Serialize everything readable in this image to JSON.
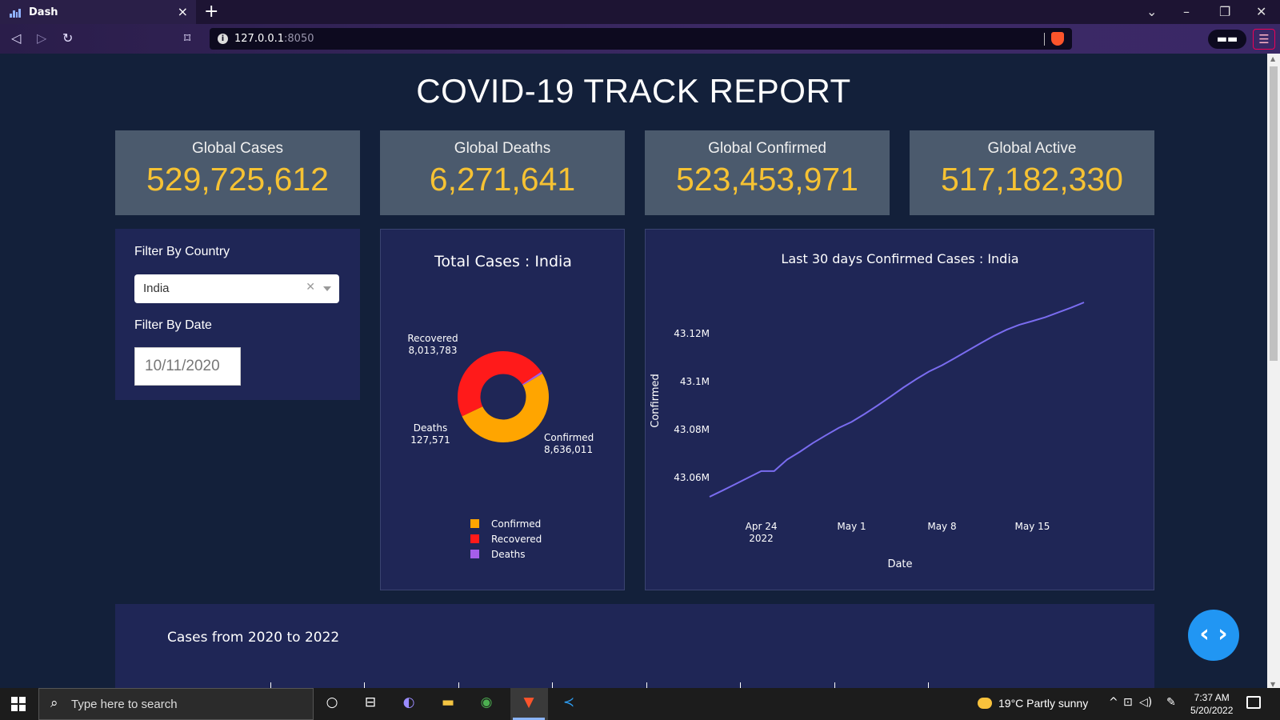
{
  "browser": {
    "tab_title": "Dash",
    "url_host": "127.0.0.1",
    "url_port": ":8050",
    "new_tab": "+",
    "tab_close": "×"
  },
  "page": {
    "title": "COVID-19 TRACK REPORT"
  },
  "kpis": [
    {
      "label": "Global Cases",
      "value": "529,725,612"
    },
    {
      "label": "Global Deaths",
      "value": "6,271,641"
    },
    {
      "label": "Global Confirmed",
      "value": "523,453,971"
    },
    {
      "label": "Global Active",
      "value": "517,182,330"
    }
  ],
  "filters": {
    "country_label": "Filter By Country",
    "country_value": "India",
    "date_label": "Filter By Date",
    "date_value": "10/11/2020"
  },
  "colors": {
    "kpi_value": "#f6c233",
    "confirmed": "#ffa500",
    "recovered": "#ff1a1a",
    "deaths": "#a55eea",
    "line": "#7a6cf0",
    "panel_bg": "#1f2656",
    "page_bg": "#13203a"
  },
  "chart_data": [
    {
      "type": "pie",
      "title": "Total Cases : India",
      "categories": [
        "Confirmed",
        "Recovered",
        "Deaths"
      ],
      "values": [
        8636011,
        8013783,
        127571
      ],
      "value_labels": [
        "8,636,011",
        "8,013,783",
        "127,571"
      ],
      "hole": 0.5,
      "legend": "bottom"
    },
    {
      "type": "line",
      "title": "Last 30 days Confirmed Cases : India",
      "xlabel": "Date",
      "ylabel": "Confirmed",
      "x": [
        "2022-04-20",
        "2022-04-21",
        "2022-04-22",
        "2022-04-23",
        "2022-04-24",
        "2022-04-25",
        "2022-04-26",
        "2022-04-27",
        "2022-04-28",
        "2022-04-29",
        "2022-04-30",
        "2022-05-01",
        "2022-05-02",
        "2022-05-03",
        "2022-05-04",
        "2022-05-05",
        "2022-05-06",
        "2022-05-07",
        "2022-05-08",
        "2022-05-09",
        "2022-05-10",
        "2022-05-11",
        "2022-05-12",
        "2022-05-13",
        "2022-05-14",
        "2022-05-15",
        "2022-05-16",
        "2022-05-17",
        "2022-05-18",
        "2022-05-19"
      ],
      "y": [
        43052000,
        43054600,
        43057300,
        43060000,
        43062700,
        43062700,
        43067500,
        43070800,
        43074400,
        43077600,
        43080700,
        43083200,
        43086500,
        43090000,
        43093700,
        43097500,
        43101000,
        43104200,
        43106800,
        43109800,
        43112900,
        43116000,
        43119000,
        43121600,
        43123700,
        43125200,
        43126800,
        43128800,
        43130800,
        43133000
      ],
      "y_ticks": [
        {
          "value": 43060000,
          "label": "43.06M"
        },
        {
          "value": 43080000,
          "label": "43.08M"
        },
        {
          "value": 43100000,
          "label": "43.1M"
        },
        {
          "value": 43120000,
          "label": "43.12M"
        }
      ],
      "x_ticks": [
        {
          "date": "2022-04-24",
          "label": "Apr 24",
          "sub": "2022"
        },
        {
          "date": "2022-05-01",
          "label": "May 1",
          "sub": ""
        },
        {
          "date": "2022-05-08",
          "label": "May 8",
          "sub": ""
        },
        {
          "date": "2022-05-15",
          "label": "May 15",
          "sub": ""
        }
      ],
      "ylim": [
        43045000,
        43140000
      ]
    }
  ],
  "bottom_chart": {
    "title": "Cases from 2020 to 2022"
  },
  "taskbar": {
    "search_placeholder": "Type here to search",
    "weather": "19°C  Partly sunny",
    "time": "7:37 AM",
    "date": "5/20/2022"
  }
}
